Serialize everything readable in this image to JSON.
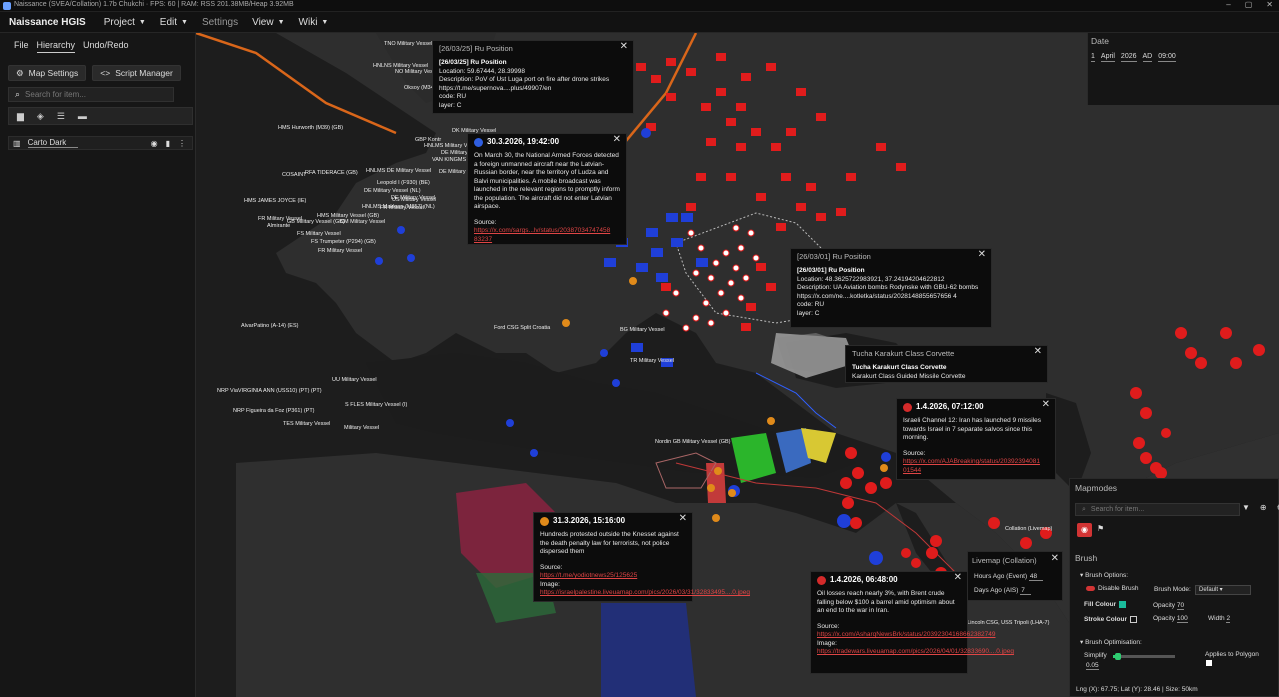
{
  "titlebar": {
    "title": "Naissance (SVEA/Collation) 1.7b Chukchi · FPS: 60 | RAM: RSS 201.38MB/Heap 3.92MB",
    "controls": [
      "–",
      "▢",
      "✕"
    ]
  },
  "menubar": {
    "app_name": "Naissance HGIS",
    "items": [
      "Project",
      "Edit",
      "Settings",
      "View",
      "Wiki"
    ]
  },
  "left_panel": {
    "tabs": [
      "File",
      "Hierarchy",
      "Undo/Redo"
    ],
    "active_tab": "Hierarchy",
    "map_settings": "Map Settings",
    "script_manager": "Script Manager",
    "search_placeholder": "Search for item...",
    "layer": {
      "name": "Carto Dark"
    }
  },
  "date_panel": {
    "title": "Date",
    "day": "1",
    "month": "April",
    "year": "2026",
    "era": "AD",
    "time": "09:00"
  },
  "popups": {
    "ru_position_1": {
      "header": "[26/03/25] Ru Position",
      "title": "[26/03/25] Ru Position",
      "location": "Location: 59.67444, 28.39998",
      "description": "Description: PoV of Ust Luga port on fire after drone strikes",
      "link": "https://t.me/supernova....plus/49907/en",
      "code": "code: RU",
      "layer": "layer: C"
    },
    "latvia": {
      "header": "30.3.2026, 19:42:00",
      "body": "On March 30, the National Armed Forces detected a foreign unmanned aircraft near the Latvian-Russian border, near the territory of Ludza and Balvi municipalities. A mobile broadcast was launched in the relevant regions to promptly inform the population. The aircraft did not enter Latvian airspace.",
      "source_label": "Source:",
      "source_link": "https://x.com/sargs...lv/status/20387034747458 83237"
    },
    "ru_position_2": {
      "header": "[26/03/01] Ru Position",
      "title": "[26/03/01] Ru Position",
      "location": "Location: 48.3625722983921, 37.24194204622812",
      "description": "Description: UA Aviation bombs Rodynske with GBU-62 bombs",
      "link": "https://x.com/ne....kotletka/status/2028148855657656 4",
      "code": "code: RU",
      "layer": "layer: C"
    },
    "corvette": {
      "header": "Tucha Karakurt Class Corvette",
      "title": "Tucha Karakurt Class Corvette",
      "subtitle": "Karakurt Class Guided Missile Corvette"
    },
    "iran": {
      "header": "1.4.2026, 07:12:00",
      "body": "Israeli Channel 12: Iran has launched 9 missiles towards Israel in 7 separate salvos since this morning.",
      "source_label": "Source:",
      "source_link": "https://x.com/AJABreaking/status/20392394081 01544"
    },
    "knesset": {
      "header": "31.3.2026, 15:16:00",
      "body": "Hundreds protested outside the Knesset against the death penalty law for terrorists, not police dispersed them",
      "source_label": "Source:",
      "source_link": "https://t.me/yodiotnews25/125625",
      "image_label": "Image:",
      "image_link": "https://israelpalestine.liveuamap.com/pics/2026/03/31/32833495....0.jpeg"
    },
    "oil": {
      "header": "1.4.2026, 06:48:00",
      "body": "Oil losses reach nearly 3%, with Brent crude falling below $100 a barrel amid optimism about an end to the war in Iran.",
      "source_label": "Source:",
      "source_link": "https://x.com/AsharqNewsBrk/status/20392304168662382749",
      "image_label": "Image:",
      "image_link": "https://tradewars.liveuamap.com/pics/2026/04/01/32833690....0.jpeg"
    }
  },
  "map_labels": [
    "TNO Military Vessel",
    "HNLNS Military Vessel",
    "NO Military Vessel",
    "Oksoy (M34",
    "HMS Hurworth (M39) (GB)",
    "DK Military Vessel",
    "GBP Kontr",
    "HNLMS Military Vessel",
    "DE Military",
    "VAN KINGMS",
    "DE Military Vessel",
    "COSAINT",
    "RFA TIDERACE (GB)",
    "HNLMS DE Military Vessel",
    "Leopold I (F930) (BE)",
    "DE Military Vessel (NL)",
    "DE Military Vessel",
    "US Military Vessel",
    "HMS JAMES JOYCE (IE)",
    "FR Military Vessel",
    "HNLMS Makkum (M857) (NL)",
    "HMS Military Vessel (GB)",
    "FR Military Vessel",
    "GB Military Vessel (GB)",
    "Almirante",
    "CM Military Vessel",
    "FS Military Vessel",
    "FS Trumpeter (P294) (GB)",
    "FR Military Vessel",
    "AlvarPatino (A-14) (ES)",
    "Ford CSG Split Croatia",
    "BG Military Vessel",
    "TR Military Vessel",
    "UU Military Vessel",
    "NRP ViaVIRGINIA ANN (USS10) (PT) (PT)",
    "S FLES Military Vessel (I)",
    "NRP Figueira da Foz (P361) (PT)",
    "TES Military Vessel",
    "Military Vessel",
    "Nordin GB Military Vessel (GB)",
    "Collation (Livemap)",
    "ham Lincoln CSG, USS Tripoli (LHA-7)"
  ],
  "mapmodes": {
    "title": "Mapmodes",
    "search_placeholder": "Search for item..."
  },
  "brush": {
    "title": "Brush",
    "options_label": "Brush Options:",
    "disable_label": "Disable Brush",
    "mode_label": "Brush Mode:",
    "mode_value": "Default",
    "fill_label": "Fill Colour",
    "fill_color": "#1abc9c",
    "opacity_label": "Opacity",
    "fill_opacity": "70",
    "stroke_label": "Stroke Colour",
    "stroke_color": "#111111",
    "stroke_opacity": "100",
    "width_label": "Width",
    "width_value": "2",
    "optimisation_label": "Brush Optimisation:",
    "simplify_label": "Simplify",
    "simplify_value": "0.05",
    "polygon_label": "Applies to Polygon",
    "coords": "Lng (X): 67.75; Lat (Y): 28.46 | Size: 50km"
  },
  "livemap": {
    "title": "Livemap (Collation)",
    "hours_label": "Hours Ago (Event)",
    "hours_value": "48",
    "days_label": "Days Ago (AIS)",
    "days_value": "7"
  },
  "colors": {
    "accent_red": "#e02020",
    "nato_blue": "#1f3fd8",
    "background": "#2b2b2b",
    "sea": "#1c1c1c"
  }
}
